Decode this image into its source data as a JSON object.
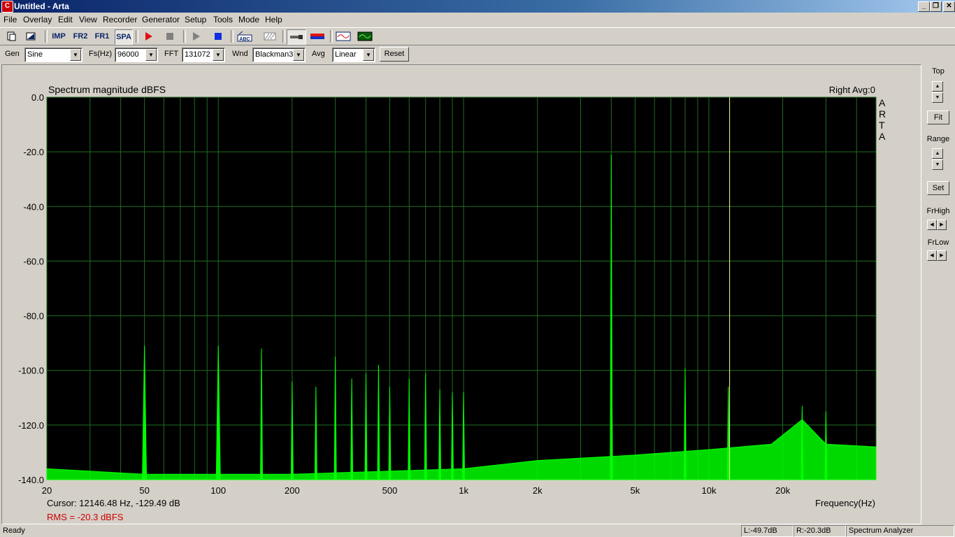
{
  "window": {
    "title": "Untitled - Arta",
    "icon": "C"
  },
  "menu": [
    "File",
    "Overlay",
    "Edit",
    "View",
    "Recorder",
    "Generator",
    "Setup",
    "Tools",
    "Mode",
    "Help"
  ],
  "toolbar": {
    "imp": "IMP",
    "fr2": "FR2",
    "fr1": "FR1",
    "spa": "SPA",
    "abc": "ABC"
  },
  "controls": {
    "gen_label": "Gen",
    "gen_value": "Sine",
    "fs_label": "Fs(Hz)",
    "fs_value": "96000",
    "fft_label": "FFT",
    "fft_value": "131072",
    "wnd_label": "Wnd",
    "wnd_value": "Blackman3",
    "avg_label": "Avg",
    "avg_value": "Linear",
    "reset": "Reset"
  },
  "plot": {
    "title": "Spectrum magnitude dBFS",
    "channel_info": "Right  Avg:0",
    "brand": [
      "A",
      "R",
      "T",
      "A"
    ],
    "cursor": "Cursor: 12146.48 Hz, -129.49 dB",
    "rms": "RMS =  -20.3 dBFS",
    "xlabel": "Frequency(Hz)"
  },
  "chart_data": {
    "type": "line",
    "title": "Spectrum magnitude dBFS",
    "xlabel": "Frequency(Hz)",
    "ylabel": "",
    "xscale": "log",
    "xlim": [
      20,
      48000
    ],
    "ylim": [
      -140,
      0
    ],
    "grid": true,
    "yticks": [
      "0.0",
      "-20.0",
      "-40.0",
      "-60.0",
      "-80.0",
      "-100.0",
      "-120.0",
      "-140.0"
    ],
    "ytick_values": [
      0,
      -20,
      -40,
      -60,
      -80,
      -100,
      -120,
      -140
    ],
    "xticks": [
      "20",
      "50",
      "100",
      "200",
      "500",
      "1k",
      "2k",
      "5k",
      "10k",
      "20k"
    ],
    "xtick_values": [
      20,
      50,
      100,
      200,
      500,
      1000,
      2000,
      5000,
      10000,
      20000
    ],
    "cursor_hz": 12146.48,
    "peaks": [
      {
        "f": 50,
        "db": -91
      },
      {
        "f": 100,
        "db": -91
      },
      {
        "f": 150,
        "db": -92
      },
      {
        "f": 200,
        "db": -104
      },
      {
        "f": 250,
        "db": -106
      },
      {
        "f": 300,
        "db": -95
      },
      {
        "f": 350,
        "db": -103
      },
      {
        "f": 400,
        "db": -101
      },
      {
        "f": 450,
        "db": -98
      },
      {
        "f": 500,
        "db": -106
      },
      {
        "f": 600,
        "db": -103
      },
      {
        "f": 700,
        "db": -101
      },
      {
        "f": 800,
        "db": -107
      },
      {
        "f": 900,
        "db": -108
      },
      {
        "f": 1000,
        "db": -108
      },
      {
        "f": 4000,
        "db": -21
      },
      {
        "f": 4010,
        "db": -84
      },
      {
        "f": 8000,
        "db": -99
      },
      {
        "f": 12000,
        "db": -106
      },
      {
        "f": 24000,
        "db": -113
      },
      {
        "f": 30000,
        "db": -115
      }
    ],
    "noise_floor": [
      {
        "f": 20,
        "db": -136
      },
      {
        "f": 50,
        "db": -138
      },
      {
        "f": 200,
        "db": -138
      },
      {
        "f": 1000,
        "db": -136
      },
      {
        "f": 2000,
        "db": -133
      },
      {
        "f": 5000,
        "db": -131
      },
      {
        "f": 10000,
        "db": -129
      },
      {
        "f": 18000,
        "db": -127
      },
      {
        "f": 24000,
        "db": -118
      },
      {
        "f": 30000,
        "db": -127
      },
      {
        "f": 48000,
        "db": -128
      }
    ]
  },
  "rightpanel": {
    "top": "Top",
    "fit": "Fit",
    "range": "Range",
    "set": "Set",
    "frhigh": "FrHigh",
    "frlow": "FrLow"
  },
  "status": {
    "ready": "Ready",
    "left": "L:-49.7dB",
    "right": "R:-20.3dB",
    "mode": "Spectrum Analyzer"
  },
  "colors": {
    "trace": "#00ff00",
    "grid": "#1f6e1f",
    "background": "#000000",
    "rms": "#cc0000",
    "cursor": "#ffff99"
  }
}
